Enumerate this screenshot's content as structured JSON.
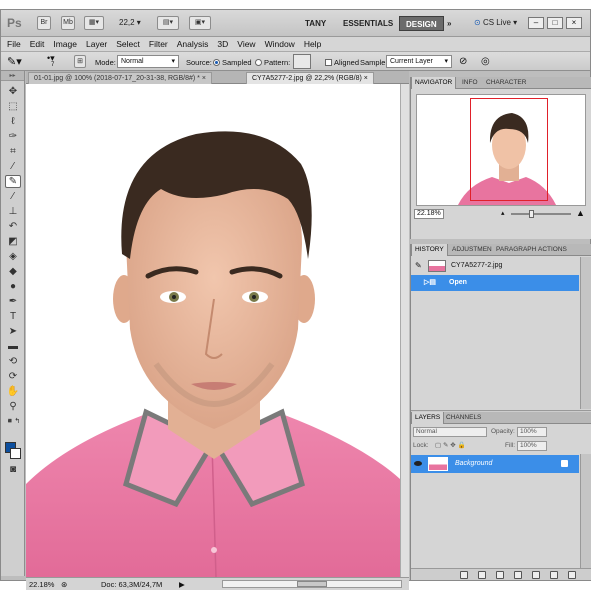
{
  "app": {
    "logo": "Ps",
    "bridge_label": "Br",
    "minibridge_label": "Mb",
    "zoom": "22,2",
    "workspaces": [
      "TANY",
      "ESSENTIALS",
      "DESIGN"
    ],
    "more_workspaces": "»",
    "cs_live": "CS Live",
    "window_buttons": [
      "–",
      "□",
      "×"
    ]
  },
  "menu": [
    "File",
    "Edit",
    "Image",
    "Layer",
    "Select",
    "Filter",
    "Analysis",
    "3D",
    "View",
    "Window",
    "Help"
  ],
  "options": {
    "brush_size": "7",
    "mode_label": "Mode:",
    "mode_value": "Normal",
    "source_label": "Source:",
    "sampled_label": "Sampled",
    "pattern_label": "Pattern:",
    "aligned_label": "Aligned",
    "sample_label": "Sample:",
    "sample_value": "Current Layer"
  },
  "documents": {
    "tabs": [
      {
        "label": "01-01.jpg @ 100% (2018-07-17_20-31-38, RGB/8#) *",
        "close": "×",
        "active": false
      },
      {
        "label": "CY7A5277-2.jpg @ 22,2% (RGB/8)",
        "close": "×",
        "active": true
      }
    ]
  },
  "status": {
    "zoom": "22.18%",
    "doc": "Doc: 63,3M/24,7M",
    "arrow": "▶"
  },
  "navigator": {
    "tabs": [
      "NAVIGATOR",
      "INFO",
      "CHARACTER"
    ],
    "zoom": "22.18%"
  },
  "history": {
    "tabs": [
      "HISTORY",
      "ADJUSTMEN",
      "PARAGRAPH",
      "ACTIONS"
    ],
    "snapshot": "CY7A5277-2.jpg",
    "states": [
      "Open"
    ]
  },
  "layers": {
    "tabs": [
      "LAYERS",
      "CHANNELS"
    ],
    "blend_mode": "Normal",
    "opacity_label": "Opacity:",
    "opacity_value": "100%",
    "lock_label": "Lock:",
    "fill_label": "Fill:",
    "fill_value": "100%",
    "items": [
      {
        "name": "Background"
      }
    ]
  },
  "colors": {
    "accent": "#3b8ee8",
    "foreground": "#0d4f9e",
    "background": "#ffffff",
    "shirt": "#e8749f"
  }
}
